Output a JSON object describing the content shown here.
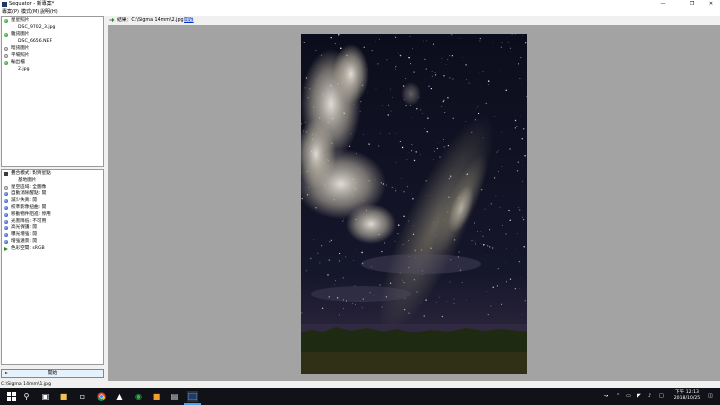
{
  "window": {
    "title": "Sequator - 新專案*"
  },
  "menu": [
    {
      "label": "專案(P)"
    },
    {
      "label": "模式(M)"
    },
    {
      "label": "說明(H)"
    }
  ],
  "file_panel": {
    "items": [
      {
        "kind": "group",
        "icon": "green",
        "label": "星星照片"
      },
      {
        "kind": "file",
        "label": "DSC_9702_3.jpg"
      },
      {
        "kind": "group",
        "icon": "green",
        "label": "雜訊圖片"
      },
      {
        "kind": "file",
        "label": "DSC_6656.NEF"
      },
      {
        "kind": "group",
        "icon": "gray",
        "label": "暗訊圖片"
      },
      {
        "kind": "group",
        "icon": "gray",
        "label": "平場照片"
      },
      {
        "kind": "group",
        "icon": "green",
        "label": "輸出檔"
      },
      {
        "kind": "file",
        "label": "2.jpg"
      }
    ]
  },
  "settings_panel": {
    "items": [
      {
        "icon": "dark",
        "label": "疊合模式: 對齊星點",
        "indent": 0
      },
      {
        "icon": "none",
        "label": "基地圖片",
        "indent": 1
      },
      {
        "icon": "gray",
        "label": "星空區域: 全圖像",
        "indent": 0
      },
      {
        "icon": "blue",
        "label": "自動消除醒點: 開",
        "indent": 0
      },
      {
        "icon": "blue",
        "label": "減少失真: 開",
        "indent": 0
      },
      {
        "icon": "blue",
        "label": "校準影像扭曲: 開",
        "indent": 0
      },
      {
        "icon": "blue",
        "label": "移動物件阻進: 停用",
        "indent": 0
      },
      {
        "icon": "blue",
        "label": "光害降低: 不可用",
        "indent": 0
      },
      {
        "icon": "blue",
        "label": "高光保護: 開",
        "indent": 0
      },
      {
        "icon": "blue",
        "label": "曝光增強: 開",
        "indent": 0
      },
      {
        "icon": "blue",
        "label": "增強遠景: 開",
        "indent": 0
      },
      {
        "icon": "arrow",
        "label": "色彩空間: sRGB",
        "indent": 0
      }
    ]
  },
  "start_button": {
    "label": "開始"
  },
  "toolbar": {
    "result_label": "結果：C:\\Sigma 14mm\\2.jpg",
    "link_label": "開啟"
  },
  "status": {
    "path": "C:\\Sigma 14mm\\1.jpg"
  },
  "taskbar": {
    "time": "下午 12:13",
    "date": "2018/10/25"
  },
  "colors": {
    "view_background": "#a3a3a3",
    "taskbar": "#101218",
    "active_indicator": "#4aa3e8"
  }
}
